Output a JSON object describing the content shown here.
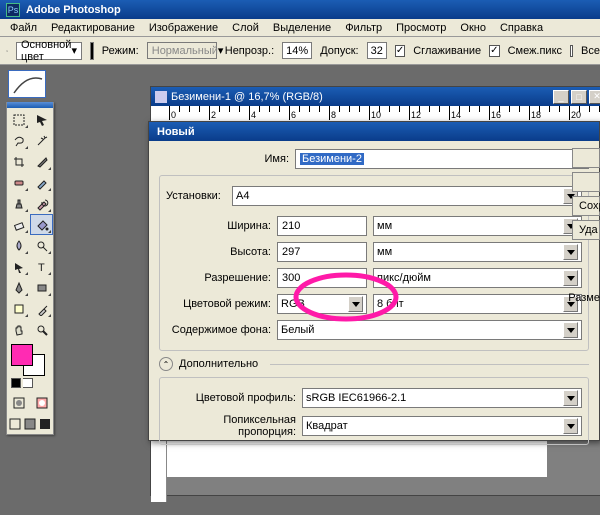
{
  "app": {
    "title": "Adobe Photoshop"
  },
  "menu": [
    "Файл",
    "Редактирование",
    "Изображение",
    "Слой",
    "Выделение",
    "Фильтр",
    "Просмотр",
    "Окно",
    "Справка"
  ],
  "optbar": {
    "fill_label": "Основной цвет",
    "mode_label": "Режим:",
    "mode_value": "Нормальный",
    "opacity_label": "Непрозр.:",
    "opacity_value": "14%",
    "tolerance_label": "Допуск:",
    "tolerance_value": "32",
    "antialias_label": "Сглаживание",
    "contiguous_label": "Смеж.пикс",
    "alllayers_label": "Все"
  },
  "docwin": {
    "title": "Безимени-1 @ 16,7% (RGB/8)"
  },
  "ruler_marks": [
    "0",
    "2",
    "4",
    "6",
    "8",
    "10",
    "12",
    "14",
    "16",
    "18",
    "20"
  ],
  "dialog": {
    "title": "Новый",
    "name_label": "Имя:",
    "name_value": "Безимени-2",
    "preset_label": "Установки:",
    "preset_value": "A4",
    "width_label": "Ширина:",
    "width_value": "210",
    "width_unit": "мм",
    "height_label": "Высота:",
    "height_value": "297",
    "height_unit": "мм",
    "res_label": "Разрешение:",
    "res_value": "300",
    "res_unit": "пикс/дюйм",
    "mode_label": "Цветовой режим:",
    "mode_value": "RGB",
    "mode_depth": "8 бит",
    "bgcontent_label": "Содержимое фона:",
    "bgcontent_value": "Белый",
    "advanced_label": "Дополнительно",
    "profile_label": "Цветовой профиль:",
    "profile_value": "sRGB IEC61966-2.1",
    "pixel_label": "Попиксельная пропорция:",
    "pixel_value": "Квадрат",
    "btn_save": "Сохр",
    "btn_delete": "Уда",
    "size_label": "Разме"
  },
  "tools": [
    "move",
    "rect-marquee",
    "lasso",
    "magic-wand",
    "crop",
    "slice",
    "healing-brush",
    "brush",
    "clone-stamp",
    "history-brush",
    "eraser",
    "paint-bucket",
    "blur",
    "dodge",
    "pen",
    "type",
    "path-selection",
    "rectangle",
    "notes",
    "eyedropper",
    "hand",
    "zoom"
  ]
}
